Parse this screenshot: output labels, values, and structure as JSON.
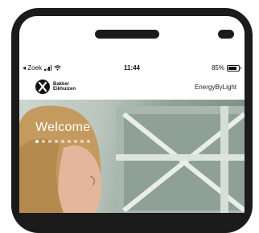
{
  "statusbar": {
    "back_label": "◂ Zoek",
    "time": "11:44",
    "battery": "85%",
    "signal_icon": "signal-bars-icon",
    "wifi_icon": "wifi-icon",
    "battery_icon": "battery-icon"
  },
  "header": {
    "logo_line1": "Bakker",
    "logo_line2": "Eikhuizen",
    "brand": "EnergyByLight"
  },
  "hero": {
    "title": "Welcome",
    "slide_count": 9,
    "active_slide": 1
  }
}
